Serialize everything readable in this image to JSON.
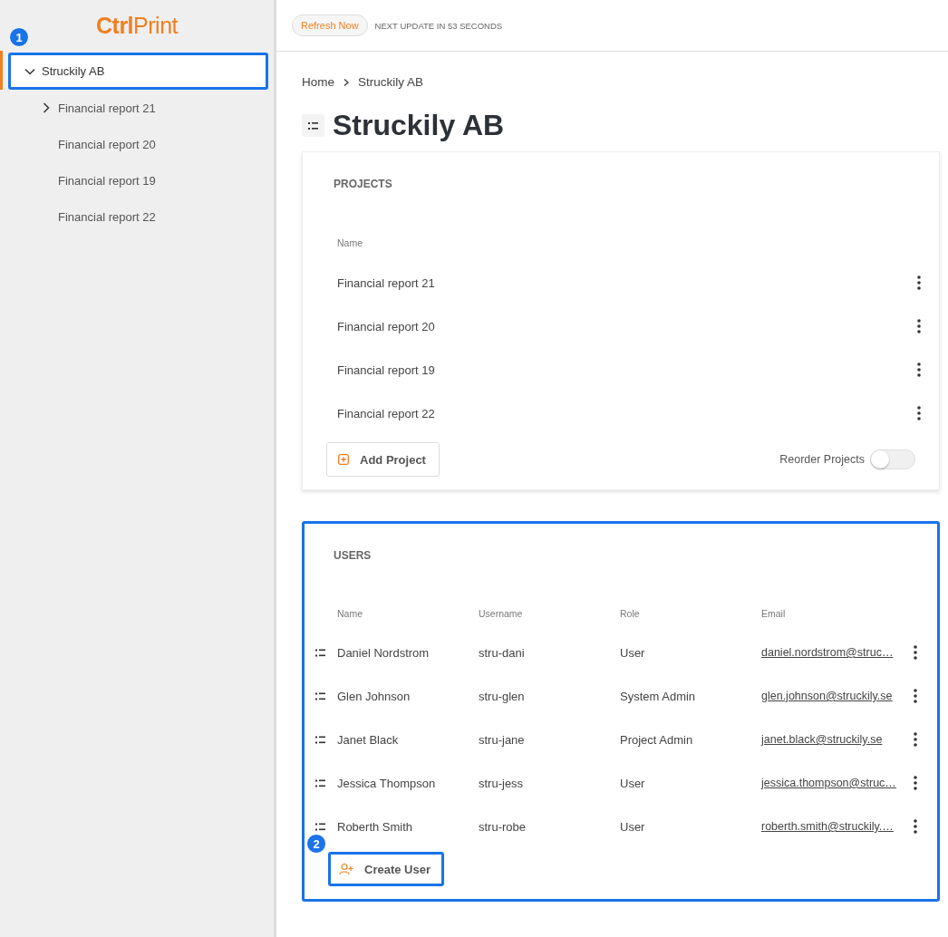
{
  "sidebar": {
    "logo": "**Ctrl**Print",
    "callout": "1",
    "tree": [
      {
        "label": "Struckily AB",
        "selected": true,
        "expanded": true,
        "highlighted": true,
        "children": [
          {
            "label": "Financial report 21",
            "selected": false,
            "expanded": false
          },
          {
            "label": "Financial report 20",
            "selected": false
          },
          {
            "label": "Financial report 19",
            "selected": false
          },
          {
            "label": "Financial report 22",
            "selected": false
          }
        ]
      }
    ]
  },
  "topbar": {
    "refresh_button": "Refresh Now",
    "update_notice": "NEXT UPDATE IN 53 SECONDS"
  },
  "breadcrumb": [
    "Home",
    "Struckily AB"
  ],
  "page_title": "Struckily AB",
  "projects": {
    "title": "PROJECTS",
    "columns": [
      "Name"
    ],
    "rows": [
      "Financial report 21",
      "Financial report 20",
      "Financial report 19",
      "Financial report 22"
    ],
    "add_button": "Add Project",
    "reorder": {
      "label": "Reorder Projects",
      "on": false
    }
  },
  "users": {
    "title": "USERS",
    "highlighted": true,
    "callout": "2",
    "columns": [
      "Name",
      "Username",
      "Role",
      "Email"
    ],
    "rows": [
      {
        "name": "Daniel Nordstrom",
        "username": "stru-dani",
        "role": "User",
        "email": "daniel.nordstrom@struc…"
      },
      {
        "name": "Glen Johnson",
        "username": "stru-glen",
        "role": "System Admin",
        "email": "glen.johnson@struckily.se"
      },
      {
        "name": "Janet Black",
        "username": "stru-jane",
        "role": "Project Admin",
        "email": "janet.black@struckily.se"
      },
      {
        "name": "Jessica Thompson",
        "username": "stru-jess",
        "role": "User",
        "email": "jessica.thompson@struc…"
      },
      {
        "name": "Roberth Smith",
        "username": "stru-robe",
        "role": "User",
        "email": "roberth.smith@struckily.…"
      }
    ],
    "create_button": {
      "label": "Create User",
      "highlighted": true
    }
  }
}
